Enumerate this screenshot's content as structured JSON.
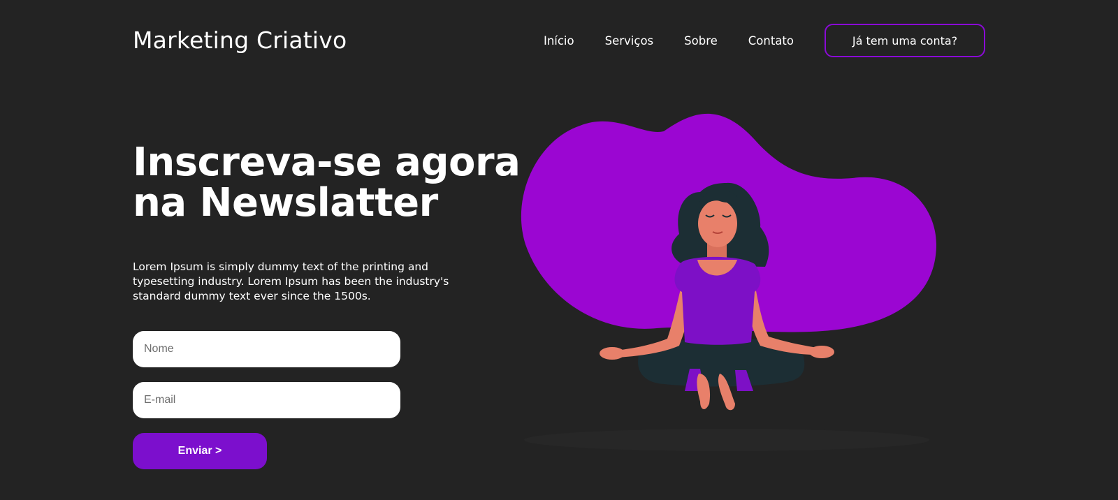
{
  "header": {
    "logo": "Marketing Criativo",
    "nav": [
      {
        "label": "Início"
      },
      {
        "label": "Serviços"
      },
      {
        "label": "Sobre"
      },
      {
        "label": "Contato"
      }
    ],
    "account_button": "Já tem uma conta?"
  },
  "hero": {
    "title_line1": "Inscreva-se agora",
    "title_line2": "na Newslatter",
    "description": "Lorem Ipsum is simply dummy text of the printing and typesetting industry. Lorem Ipsum has been the industry's standard dummy text ever since the 1500s."
  },
  "form": {
    "name_placeholder": "Nome",
    "email_placeholder": "E-mail",
    "submit_label": "Enviar >"
  },
  "illustration": {
    "icon": "meditating-woman-icon"
  },
  "colors": {
    "background": "#232323",
    "accent": "#8a0ad6",
    "blob": "#9b06d2",
    "button": "#7c0fcd",
    "skin": "#e8806a",
    "hair": "#1c2e34"
  }
}
